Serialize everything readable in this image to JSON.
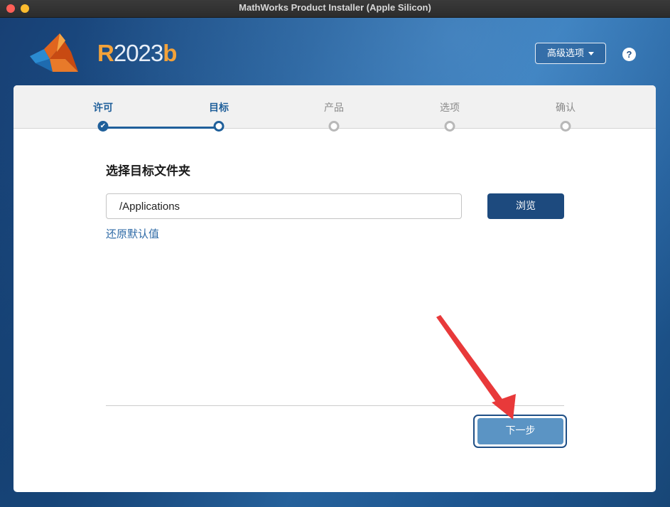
{
  "window": {
    "title": "MathWorks Product Installer (Apple Silicon)"
  },
  "header": {
    "release_prefix": "R",
    "release_number": "2023",
    "release_suffix": "b",
    "advanced_options_label": "高级选项",
    "help_label": "?"
  },
  "steps": [
    {
      "label": "许可",
      "state": "done"
    },
    {
      "label": "目标",
      "state": "current"
    },
    {
      "label": "产品",
      "state": "pending"
    },
    {
      "label": "选项",
      "state": "pending"
    },
    {
      "label": "确认",
      "state": "pending"
    }
  ],
  "main": {
    "section_title": "选择目标文件夹",
    "folder_value": "/Applications",
    "browse_label": "浏览",
    "restore_default_label": "还原默认值",
    "next_label": "下一步"
  },
  "colors": {
    "accent": "#1f5f9a",
    "browse_button": "#1d4a7e",
    "next_button": "#5b94c4",
    "link": "#2e6aa6",
    "annotation_arrow": "#e8393a"
  },
  "icons": {
    "logo": "matlab-membrane-icon",
    "help": "help-icon",
    "check": "check-icon",
    "dropdown": "chevron-down-icon"
  }
}
